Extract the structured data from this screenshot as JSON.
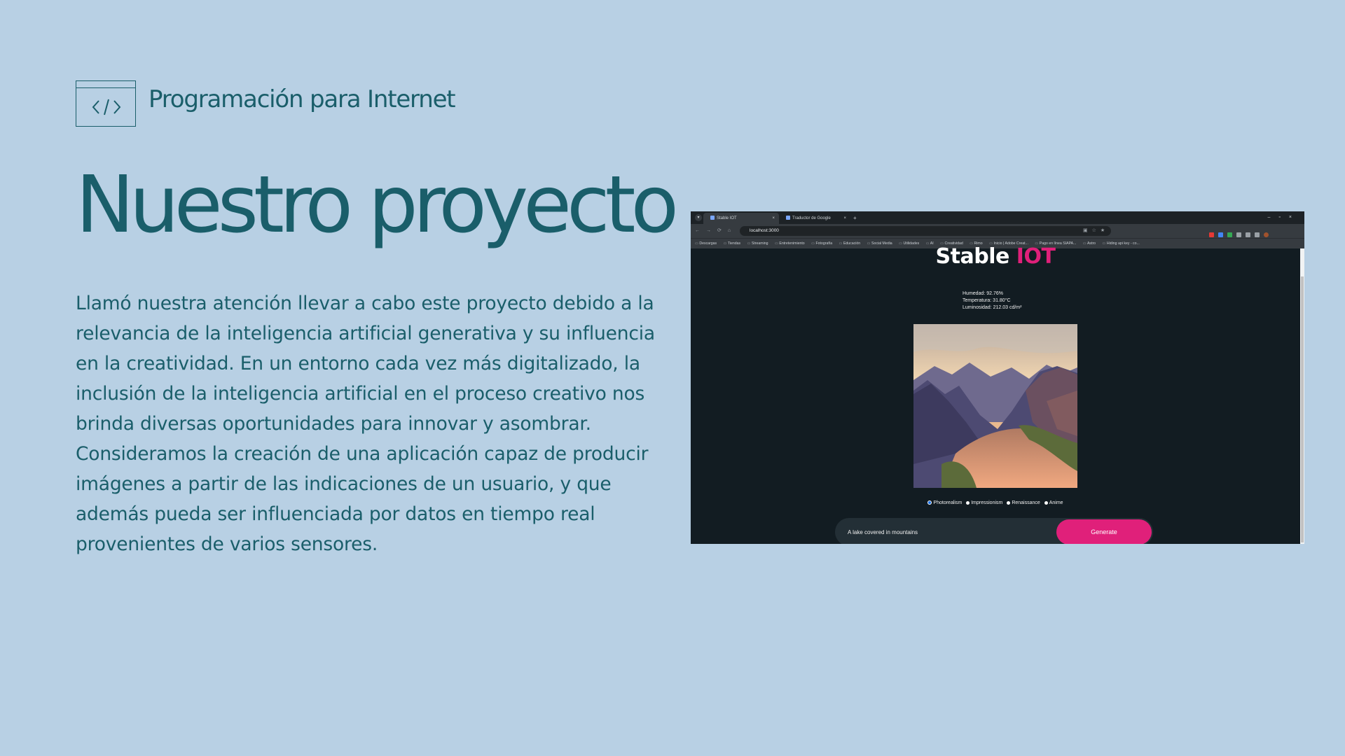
{
  "header": {
    "icon": "code-icon",
    "course": "Programación para Internet"
  },
  "title": "Nuestro proyecto",
  "body": "Llamó nuestra atención llevar a cabo este proyecto debido a la relevancia de la inteligencia artificial generativa y su influencia en la creatividad. En un entorno cada vez más digitalizado, la inclusión de la inteligencia artificial en el proceso creativo nos brinda diversas oportunidades para innovar y asombrar. Consideramos la creación de una aplicación capaz de producir imágenes a partir de las indicaciones de un usuario, y que además pueda ser influenciada por datos en tiempo real provenientes de varios sensores.",
  "colors": {
    "background": "#b8d0e4",
    "text": "#1a5e6a",
    "accent": "#e0207a"
  },
  "browser": {
    "tabs": [
      {
        "label": "Stable IOT"
      },
      {
        "label": "Traductor de Google"
      }
    ],
    "url": "localhost:3000",
    "bookmarks": [
      "Descargas",
      "Tiendas",
      "Streaming",
      "Entretenimiento",
      "Fotografía",
      "Educación",
      "Social Media",
      "Utilidades",
      "AI",
      "Creatividad",
      "Rimo",
      "Inicio | Adobe Creat...",
      "Pago en línea SIAPA...",
      "Astro",
      "Hiding api key - co..."
    ],
    "app": {
      "title_main": "Stable ",
      "title_accent": "IOT",
      "sensors": {
        "humidity": "Humedad: 92.76%",
        "temperature": "Temperatura: 31.80°C",
        "luminosity": "Luminosidad: 212.03 cd/m²"
      },
      "styles": [
        "Photorealism",
        "Impressionism",
        "Renaissance",
        "Anime"
      ],
      "selected_style": "Photorealism",
      "prompt_value": "A lake covered in mountains",
      "generate_label": "Generate"
    }
  }
}
